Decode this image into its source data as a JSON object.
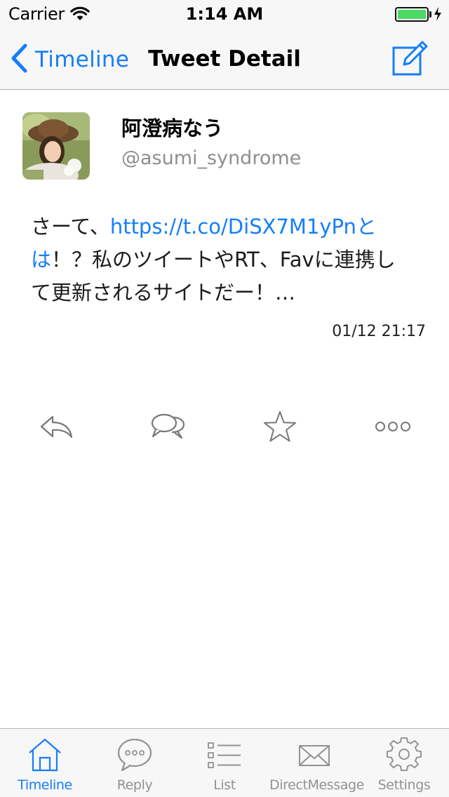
{
  "status_bar": {
    "carrier": "Carrier",
    "time": "1:14 AM",
    "battery_level": 1.0
  },
  "nav": {
    "back_label": "Timeline",
    "title": "Tweet Detail"
  },
  "tweet": {
    "user_name": "阿澄病なう",
    "handle": "@asumi_syndrome",
    "text_prefix": "さーて、",
    "link": "https://t.co/DiSX7M1yPnとは",
    "text_suffix": "！？私のツイートやRT、Favに連携して更新されるサイトだー！…",
    "timestamp": "01/12 21:17"
  },
  "actions": [
    "reply-icon",
    "conversation-icon",
    "star-icon",
    "more-icon"
  ],
  "tab_bar": {
    "tabs": [
      {
        "label": "Timeline",
        "icon": "home-icon",
        "active": true
      },
      {
        "label": "Reply",
        "icon": "speech-bubble-icon",
        "active": false
      },
      {
        "label": "List",
        "icon": "list-icon",
        "active": false
      },
      {
        "label": "DirectMessage",
        "icon": "envelope-icon",
        "active": false
      },
      {
        "label": "Settings",
        "icon": "gear-icon",
        "active": false
      }
    ]
  },
  "colors": {
    "accent": "#157efb",
    "inactive": "#929292",
    "battery": "#4cd964",
    "bar_background": "#f7f7f7"
  }
}
